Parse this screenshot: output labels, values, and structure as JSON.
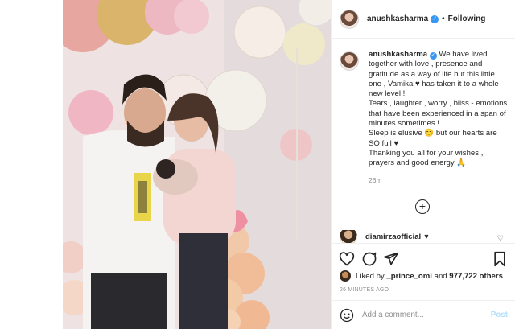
{
  "post": {
    "username": "anushkasharma",
    "follow_state": "Following",
    "separator": "•",
    "verified_mark": "✓",
    "photo_alt": "Couple holding newborn baby in front of pink and gold balloons"
  },
  "caption": {
    "username": "anushkasharma",
    "text": "We have lived together with love , presence and gratitude as a way of life but this little one , Vamika ♥ has taken it to a whole new level !\nTears , laughter , worry , bliss - emotions that have been experienced in a span of minutes sometimes !\nSleep is elusive 😊 but our hearts are SO full ♥\nThanking you all for your wishes , prayers and good energy 🙏",
    "time": "26m"
  },
  "load_more": {
    "label": "+"
  },
  "comment": {
    "username": "diamirzaofficial",
    "text": "♥"
  },
  "likes": {
    "prefix": "Liked by",
    "first_user": "_prince_omi",
    "middle": "and",
    "count": "977,722 others"
  },
  "timestamp": "26 MINUTES AGO",
  "add_comment": {
    "placeholder": "Add a comment...",
    "post_label": "Post"
  },
  "icons": {
    "like": "heart-icon",
    "comment": "comment-icon",
    "share": "share-icon",
    "save": "bookmark-icon",
    "emoji": "emoji-icon",
    "verified": "verified-badge-icon"
  }
}
